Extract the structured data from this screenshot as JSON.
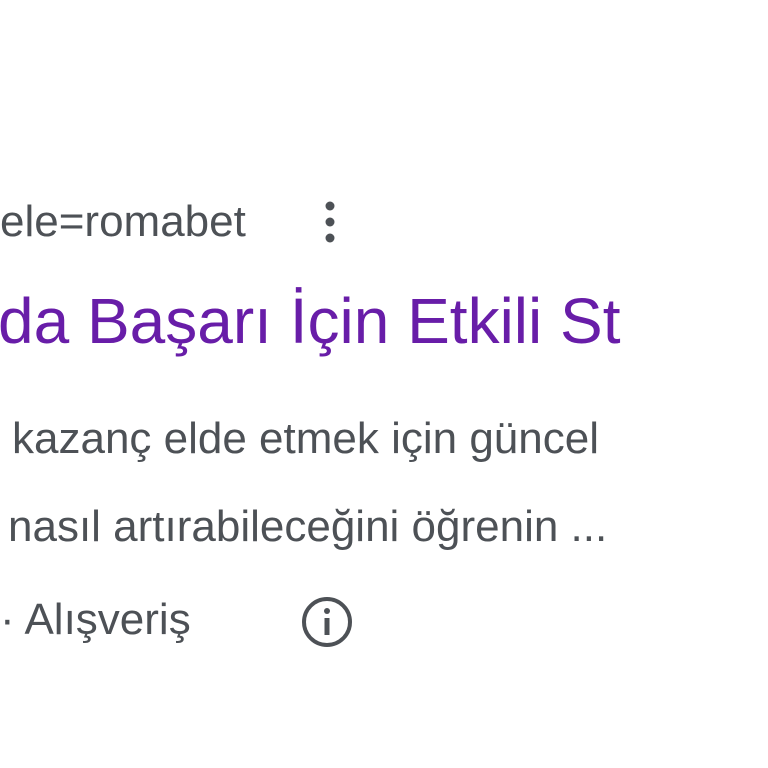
{
  "result": {
    "url_fragment": "ele=romabet",
    "title": "da Başarı İçin Etkili St",
    "snippet_line1": "kazanç elde etmek için güncel",
    "snippet_line2": "nasıl artırabileceğini öğrenin ...",
    "meta": "· Alışveriş",
    "more_options_icon": "more-vert-icon",
    "info_icon": "info-icon"
  },
  "colors": {
    "title": "#681da8",
    "text": "#4d5156",
    "background": "#ffffff"
  }
}
